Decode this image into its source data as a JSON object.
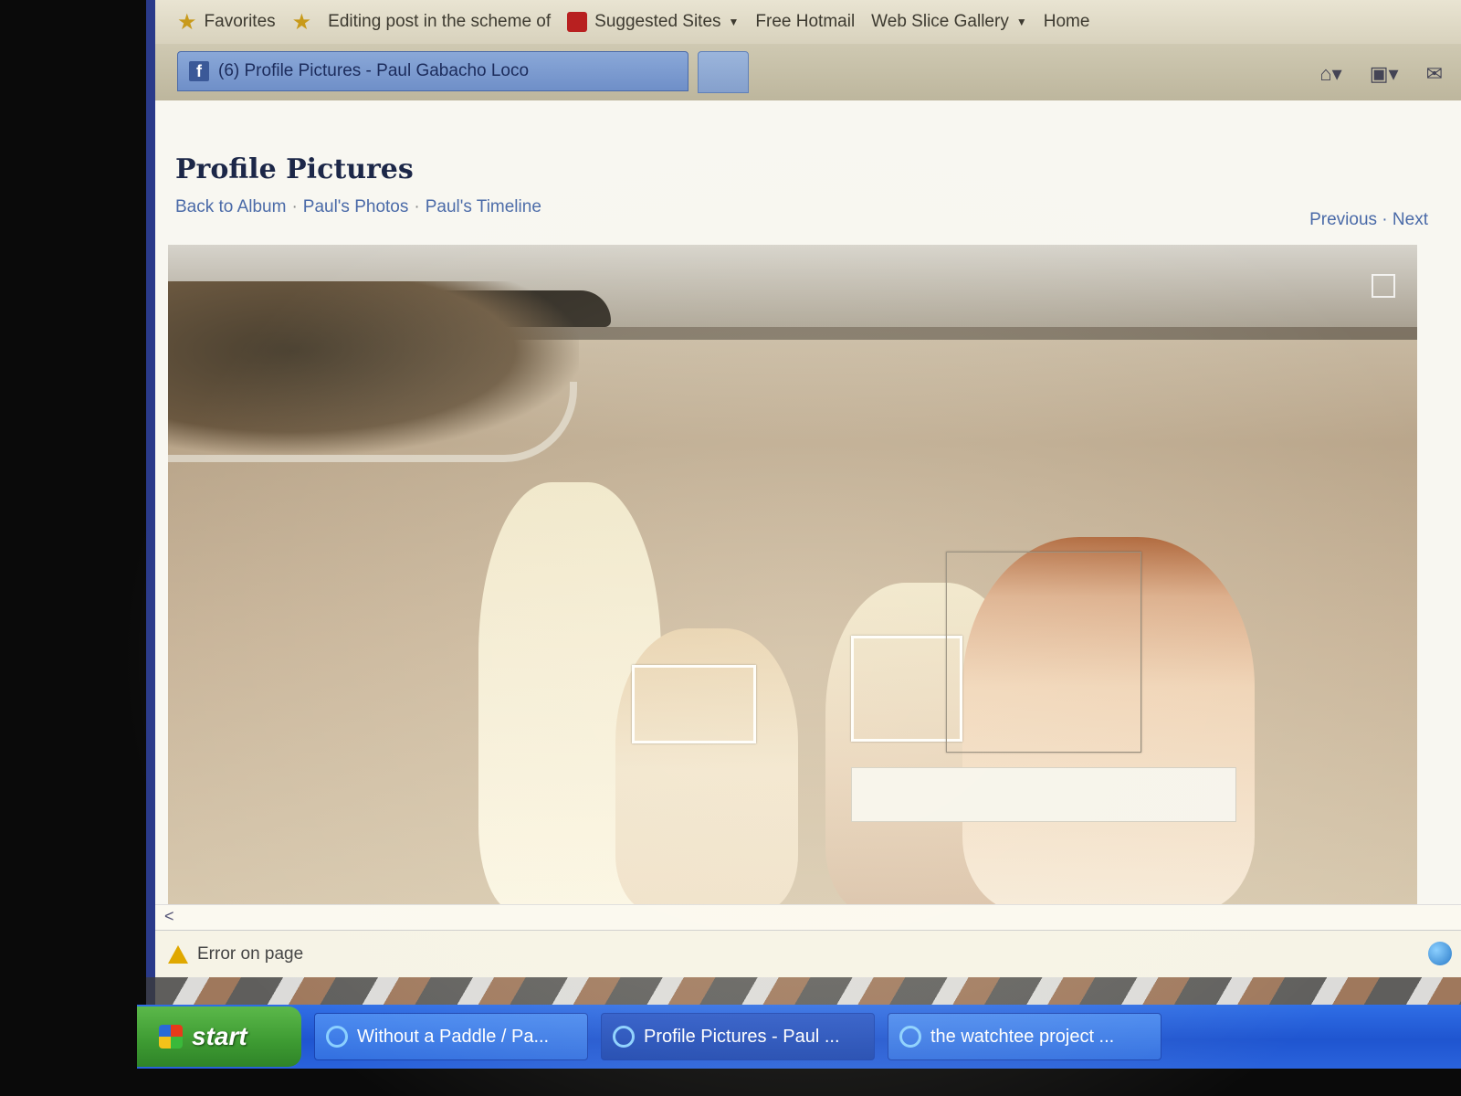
{
  "favorites_bar": {
    "label": "Favorites",
    "items": [
      {
        "label": "Editing post in the scheme of"
      },
      {
        "label": "Suggested Sites"
      },
      {
        "label": "Free Hotmail"
      },
      {
        "label": "Web Slice Gallery"
      },
      {
        "label": "Home"
      }
    ]
  },
  "tab": {
    "title": "(6) Profile Pictures - Paul Gabacho Loco"
  },
  "page": {
    "title": "Profile Pictures",
    "links": [
      "Back to Album",
      "Paul's Photos",
      "Paul's Timeline"
    ],
    "previous": "Previous",
    "next": "Next"
  },
  "status_bar": {
    "text": "Error on page"
  },
  "taskbar": {
    "start_label": "start",
    "tasks": [
      {
        "label": "Without a Paddle / Pa..."
      },
      {
        "label": "Profile Pictures - Paul ..."
      },
      {
        "label": "the watchtee project ..."
      }
    ]
  }
}
